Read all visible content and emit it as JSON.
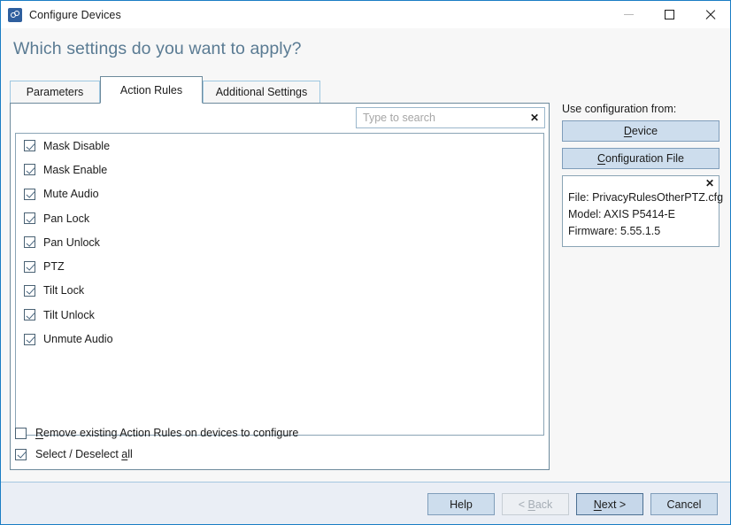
{
  "window": {
    "title": "Configure Devices",
    "icon": "link-chain-icon",
    "controls": {
      "minimize": "minimize-icon",
      "maximize": "maximize-icon",
      "close": "close-icon"
    }
  },
  "header": {
    "title": "Which settings do you want to apply?"
  },
  "tabs": [
    {
      "label": "Parameters",
      "active": false
    },
    {
      "label": "Action Rules",
      "active": true
    },
    {
      "label": "Additional Settings",
      "active": false
    }
  ],
  "search": {
    "value": "",
    "placeholder": "Type to search",
    "clear_label": "✕"
  },
  "action_rules": [
    {
      "label": "Mask Disable",
      "checked": true
    },
    {
      "label": "Mask Enable",
      "checked": true
    },
    {
      "label": "Mute Audio",
      "checked": true
    },
    {
      "label": "Pan Lock",
      "checked": true
    },
    {
      "label": "Pan Unlock",
      "checked": true
    },
    {
      "label": "PTZ",
      "checked": true
    },
    {
      "label": "Tilt Lock",
      "checked": true
    },
    {
      "label": "Tilt Unlock",
      "checked": true
    },
    {
      "label": "Unmute Audio",
      "checked": true
    }
  ],
  "bottom_options": {
    "remove_existing": {
      "label": "Remove existing Action Rules on devices to configure",
      "mnemonic": "R",
      "checked": false
    },
    "select_all": {
      "label": "Select / Deselect all",
      "mnemonic": "a",
      "checked": true
    }
  },
  "side_panel": {
    "label": "Use configuration from:",
    "buttons": [
      {
        "label": "Device",
        "mnemonic": "D"
      },
      {
        "label": "Configuration File",
        "mnemonic": "C"
      }
    ],
    "info": {
      "close_label": "✕",
      "file": "File: PrivacyRulesOtherPTZ.cfg",
      "model": "Model: AXIS P5414-E",
      "firmware": "Firmware: 5.55.1.5"
    }
  },
  "footer": {
    "buttons": [
      {
        "label": "Help",
        "state": "normal"
      },
      {
        "label": "< Back",
        "state": "disabled"
      },
      {
        "label": "Next >",
        "state": "default"
      },
      {
        "label": "Cancel",
        "state": "normal"
      }
    ]
  },
  "colors": {
    "window_border": "#1a7dc4",
    "header_text": "#5a7b93",
    "button_face": "#cddded",
    "button_border": "#7f9dba",
    "footer_bg": "#eaeef5",
    "panel_border": "#6d8a9c"
  }
}
